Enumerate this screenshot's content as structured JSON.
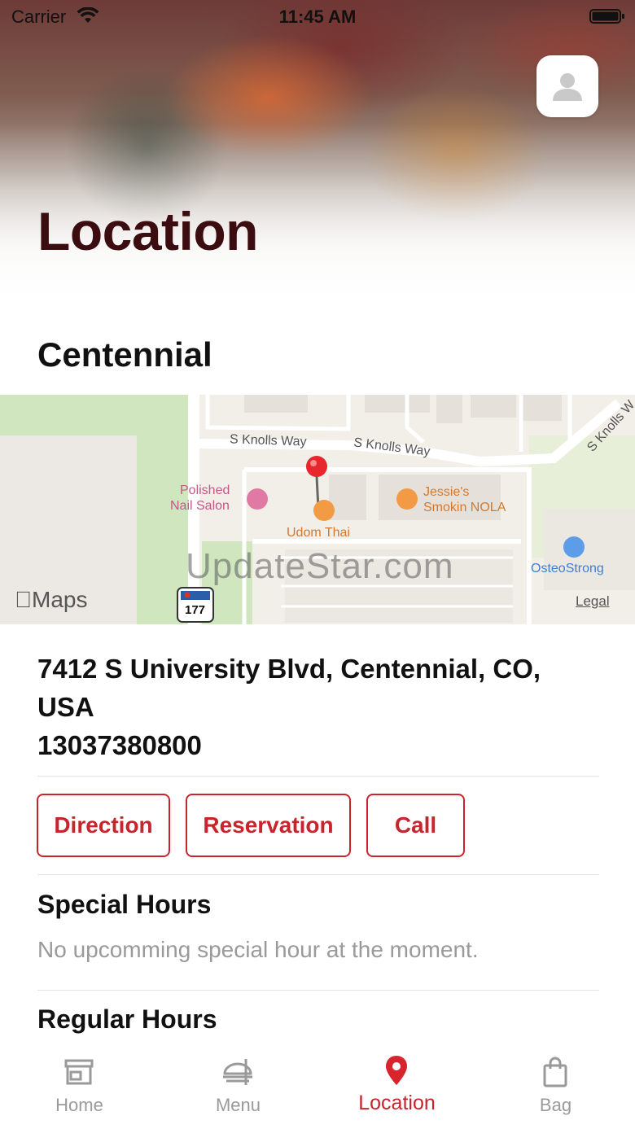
{
  "status_bar": {
    "carrier": "Carrier",
    "time": "11:45 AM"
  },
  "header": {
    "title": "Location"
  },
  "store": {
    "name": "Centennial"
  },
  "map": {
    "labels": {
      "street_1": "S Knolls Way",
      "street_2": "S Knolls Way",
      "street_3": "S Knolls W",
      "poi_salon_line1": "Polished",
      "poi_salon_line2": "Nail Salon",
      "poi_restaurant": "Udom Thai",
      "poi_bbq_line1": "Jessie's",
      "poi_bbq_line2": "Smokin NOLA",
      "poi_gym": "OsteoStrong",
      "route_shield": "177"
    },
    "attribution": "Maps",
    "legal": "Legal",
    "watermark": "UpdateStar.com"
  },
  "address": {
    "line1": "7412 S University Blvd, Centennial, CO,",
    "line2": "USA",
    "phone": "13037380800"
  },
  "actions": {
    "direction": "Direction",
    "reservation": "Reservation",
    "call": "Call"
  },
  "special_hours": {
    "title": "Special Hours",
    "note": "No upcomming special hour at the moment."
  },
  "regular_hours": {
    "title": "Regular Hours"
  },
  "tabs": [
    {
      "label": "Home",
      "icon": "store-icon",
      "active": false
    },
    {
      "label": "Menu",
      "icon": "food-tray-icon",
      "active": false
    },
    {
      "label": "Location",
      "icon": "map-pin-icon",
      "active": true
    },
    {
      "label": "Bag",
      "icon": "shopping-bag-icon",
      "active": false
    }
  ],
  "colors": {
    "accent": "#c8242c",
    "title": "#3b0c10",
    "muted": "#9a9a9a"
  }
}
